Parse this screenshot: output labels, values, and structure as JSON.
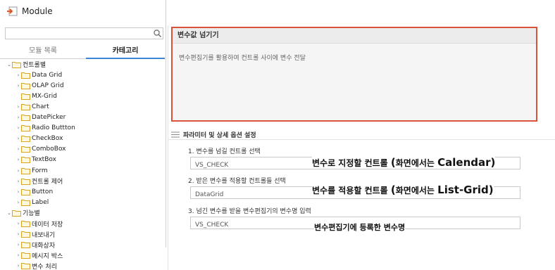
{
  "window": {
    "title": "Module"
  },
  "sidebar": {
    "tabs": [
      {
        "label": "모듈 목록"
      },
      {
        "label": "카테고리"
      }
    ],
    "tree": [
      {
        "label": "컨트롤별",
        "level": 0,
        "expanded": true
      },
      {
        "label": "Data Grid",
        "level": 1
      },
      {
        "label": "OLAP Grid",
        "level": 1
      },
      {
        "label": "MX-Grid",
        "level": 1
      },
      {
        "label": "Chart",
        "level": 1
      },
      {
        "label": "DatePicker",
        "level": 1
      },
      {
        "label": "Radio Buttton",
        "level": 1
      },
      {
        "label": "CheckBox",
        "level": 1
      },
      {
        "label": "ComboBox",
        "level": 1
      },
      {
        "label": "TextBox",
        "level": 1
      },
      {
        "label": "Form",
        "level": 1
      },
      {
        "label": "컨트롤 제어",
        "level": 1
      },
      {
        "label": "Button",
        "level": 1
      },
      {
        "label": "Label",
        "level": 1
      },
      {
        "label": "기능별",
        "level": 0,
        "expanded": true
      },
      {
        "label": "데이터 저장",
        "level": 1
      },
      {
        "label": "내보내기",
        "level": 1
      },
      {
        "label": "대화상자",
        "level": 1
      },
      {
        "label": "메시지 박스",
        "level": 1
      },
      {
        "label": "변수 처리",
        "level": 1
      }
    ]
  },
  "main": {
    "description": {
      "title": "변수값 넘기기",
      "text": "변수편집기를 활용하여 컨트롤 사이에 변수 전달"
    },
    "params": {
      "section_title": "파라미터 및 상세 옵션 설정",
      "fields": [
        {
          "label": "1. 변수를 넘길 컨트롤 선택",
          "value": "VS_CHECK"
        },
        {
          "label": "2. 받은 변수를 적용할 컨트롤들 선택",
          "value": "DataGrid"
        },
        {
          "label": "3. 넘긴 변수를 받을 변수편집기의 변수명 입력",
          "value": "VS_CHECK"
        }
      ]
    },
    "annotations": {
      "a1_text": "변수로 지정할 컨트롤 ",
      "a1_paren": "(",
      "a1_mid": "화면에서는 ",
      "a1_strong": "Calendar)",
      "a2_text": "변수를 적용할 컨트롤 ",
      "a2_paren": "(",
      "a2_mid": "화면에서는 ",
      "a2_strong": "List-Grid)",
      "a3_text": "변수편집기에 등록한 변수명"
    }
  },
  "colors": {
    "accent_tab": "#3a87d6",
    "highlight_border": "#d9533a",
    "folder": "#f0c04a"
  },
  "icons": {
    "app": "module-icon",
    "search": "search-icon",
    "folder": "folder-icon",
    "section": "list-icon"
  }
}
